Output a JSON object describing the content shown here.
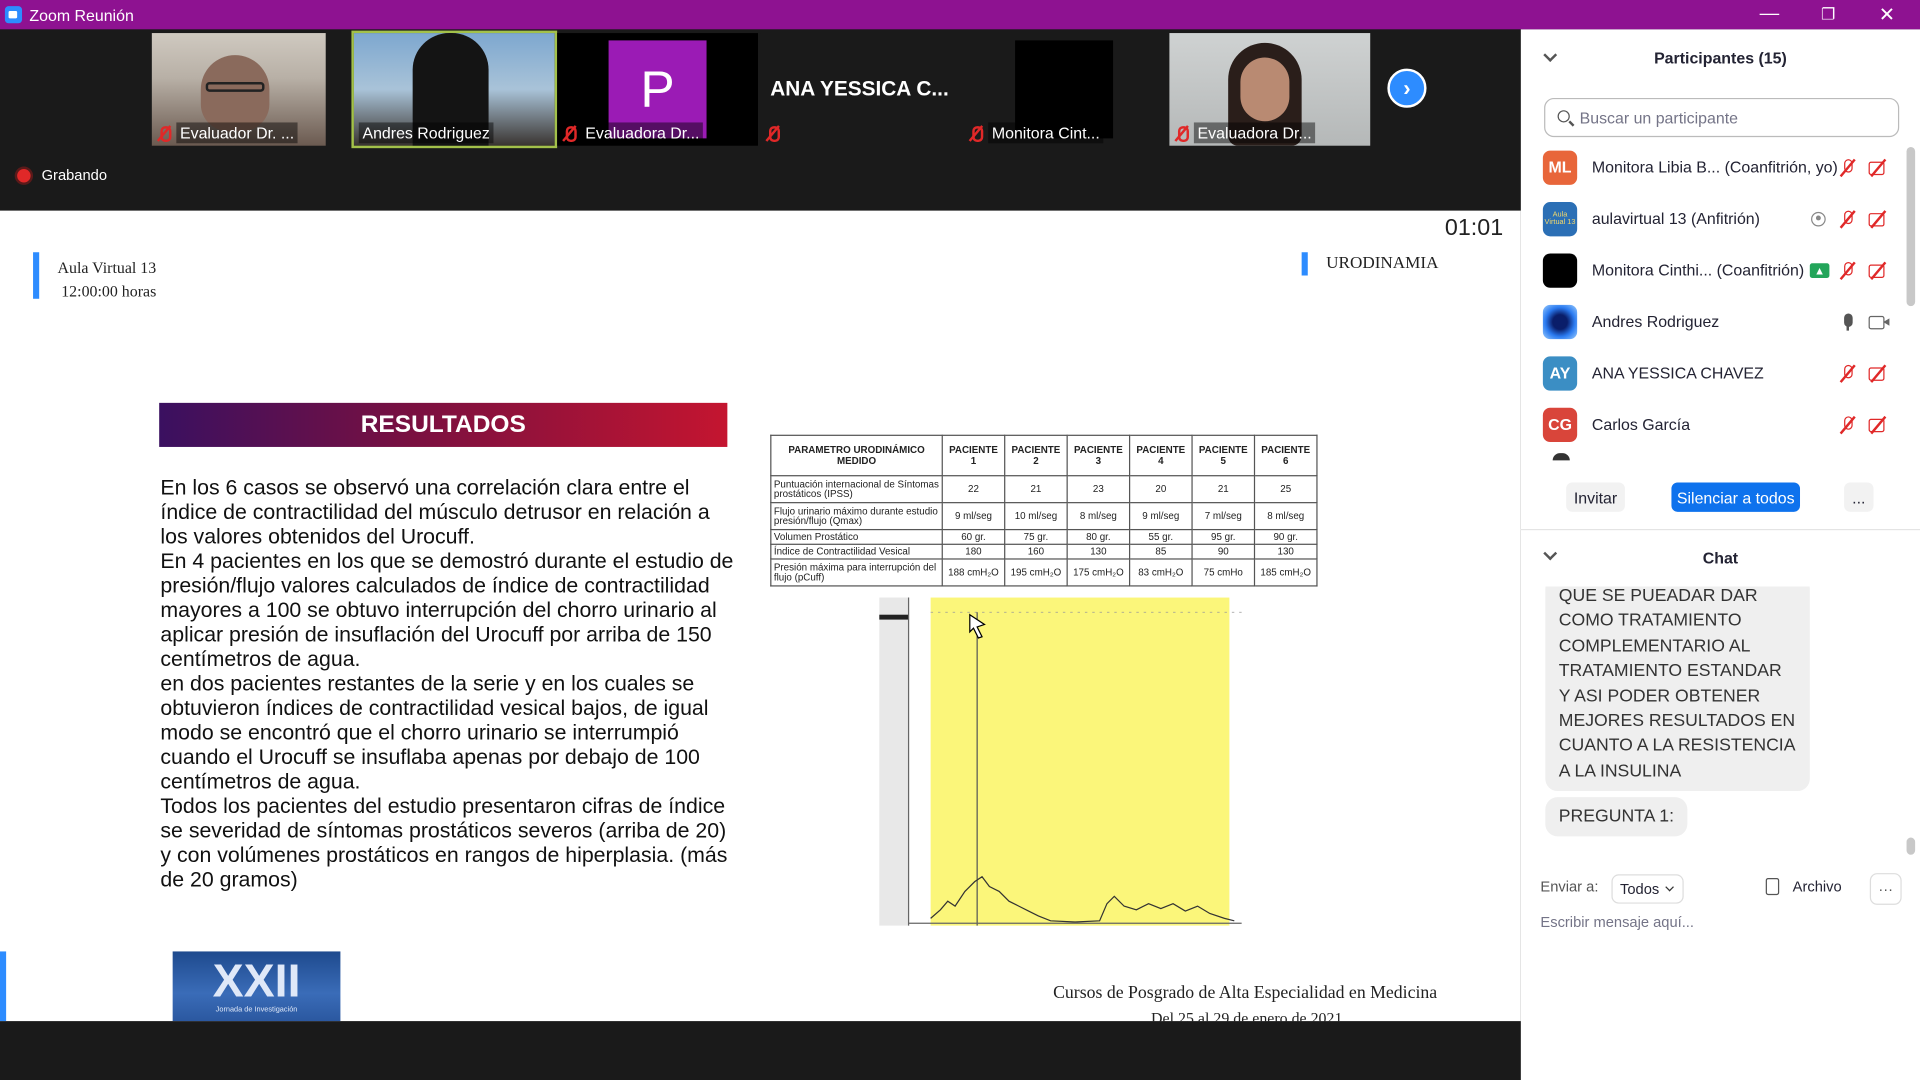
{
  "window": {
    "title": "Zoom Reunión",
    "minimize": "—",
    "restore": "❐",
    "close": "✕"
  },
  "strip": {
    "tiles": [
      {
        "name": "Evaluador Dr. ...",
        "muted": true
      },
      {
        "name": "Andres Rodriguez",
        "muted": false
      },
      {
        "name": "Evaluadora Dr...",
        "muted": true,
        "initial": "P"
      },
      {
        "name": "ANA YESSICA C...",
        "muted": true
      },
      {
        "name": "Monitora Cint...",
        "muted": true
      },
      {
        "name": "Evaluadora Dr...",
        "muted": true
      }
    ],
    "next": "›",
    "recording": "Grabando"
  },
  "slide": {
    "timer": "01:01",
    "aula_line1": "Aula Virtual 13",
    "aula_line2": "12:00:00 horas",
    "topic": "URODINAMIA",
    "results_title": "RESULTADOS",
    "paragraphs": [
      "En los 6 casos se observó una correlación clara entre el índice de contractilidad del músculo detrusor en relación a los valores obtenidos del Urocuff.",
      "En 4 pacientes en los que se demostró durante el estudio de presión/flujo valores calculados de índice de contractilidad mayores a 100 se obtuvo interrupción del chorro urinario al aplicar presión de insuflación del Urocuff por arriba de 150 centímetros de agua.",
      "en dos pacientes restantes de la serie y en los cuales se obtuvieron índices de contractilidad vesical bajos, de igual modo se encontró que el chorro urinario se interrumpió cuando el Urocuff se insuflaba apenas por debajo de 100 centímetros de agua.",
      "Todos los pacientes del estudio presentaron cifras de índice se severidad de síntomas prostáticos severos (arriba de 20) y con volúmenes prostáticos en rangos de hiperplasia. (más de 20 gramos)"
    ],
    "table": {
      "header": [
        "PARAMETRO URODINÁMICO MEDIDO",
        "PACIENTE 1",
        "PACIENTE 2",
        "PACIENTE 3",
        "PACIENTE 4",
        "PACIENTE 5",
        "PACIENTE 6"
      ],
      "rows": [
        [
          "Puntuación internacional de Síntomas prostáticos (IPSS)",
          "22",
          "21",
          "23",
          "20",
          "21",
          "25"
        ],
        [
          "Flujo urinario máximo durante estudio presión/flujo (Qmax)",
          "9 ml/seg",
          "10 ml/seg",
          "8 ml/seg",
          "9 ml/seg",
          "7 ml/seg",
          "8 ml/seg"
        ],
        [
          "Volumen Prostático",
          "60 gr.",
          "75 gr.",
          "80 gr.",
          "55 gr.",
          "95 gr.",
          "90 gr."
        ],
        [
          "Índice de Contractilidad Vesical",
          "180",
          "160",
          "130",
          "85",
          "90",
          "130"
        ],
        [
          "Presión máxima para interrupción del flujo (pCuff)",
          "188 cmH₂O",
          "195 cmH₂O",
          "175 cmH₂O",
          "83 cmH₂O",
          "75 cmHo",
          "185 cmH₂O"
        ]
      ]
    },
    "logo_text": "XXII",
    "logo_sub": "Jornada de Investigación",
    "footer_line1": "Cursos de Posgrado de Alta Especialidad en Medicina",
    "footer_line2": "Del 25 al 29 de enero de 2021"
  },
  "panel": {
    "participants_title": "Participantes (15)",
    "search_placeholder": "Buscar un participante",
    "participants": [
      {
        "initials": "ML",
        "name": "Monitora Libia B... (Coanfitrión, yo)",
        "color": "#e8663a",
        "mic": "off",
        "cam": "off"
      },
      {
        "initials": "Aula Virtual 13",
        "name": "aulavirtual 13 (Anfitrión)",
        "color": "#2b6fb5",
        "mic": "off",
        "cam": "off",
        "recording": true
      },
      {
        "initials": "",
        "name": "Monitora Cinthi... (Coanfitrión)",
        "color": "#000000",
        "mic": "off",
        "cam": "off",
        "sharing": true
      },
      {
        "initials": "",
        "name": "Andres Rodriguez",
        "color": "#1e5fd6",
        "mic": "on",
        "cam": "on"
      },
      {
        "initials": "AY",
        "name": "ANA YESSICA CHAVEZ",
        "color": "#3b8ec4",
        "mic": "off",
        "cam": "off"
      },
      {
        "initials": "CG",
        "name": "Carlos García",
        "color": "#d9453a",
        "mic": "off",
        "cam": "off"
      }
    ],
    "invite": "Invitar",
    "mute_all": "Silenciar a todos",
    "more": "...",
    "chat_title": "Chat",
    "messages": [
      "QUE SE PUEADAR DAR COMO TRATAMIENTO COMPLEMENTARIO AL TRATAMIENTO ESTANDAR Y ASI PODER OBTENER MEJORES RESULTADOS EN CUANTO A LA RESISTENCIA A LA INSULINA",
      "PREGUNTA 1:"
    ],
    "send_to_label": "Enviar a:",
    "send_to_value": "Todos",
    "file": "Archivo",
    "more_dots": "···",
    "input_placeholder": "Escribir mensaje aquí..."
  }
}
